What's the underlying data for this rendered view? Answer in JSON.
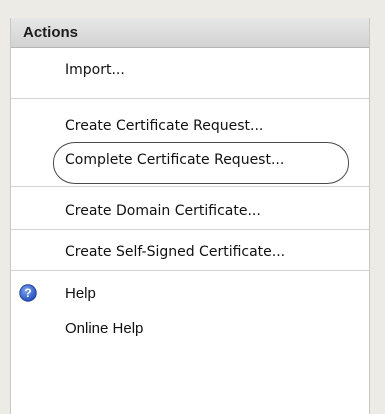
{
  "actions_panel": {
    "title": "Actions",
    "items": [
      {
        "label": "Import..."
      },
      {
        "label": "Create Certificate Request..."
      },
      {
        "label": "Complete Certificate Request..."
      },
      {
        "label": "Create Domain Certificate..."
      },
      {
        "label": "Create Self-Signed Certificate..."
      },
      {
        "label": "Help",
        "icon": "help-icon"
      },
      {
        "label": "Online Help"
      }
    ]
  },
  "colors": {
    "header_bg": "#d9d9d9",
    "panel_bg": "#ffffff",
    "help_icon": "#2b56c6"
  }
}
